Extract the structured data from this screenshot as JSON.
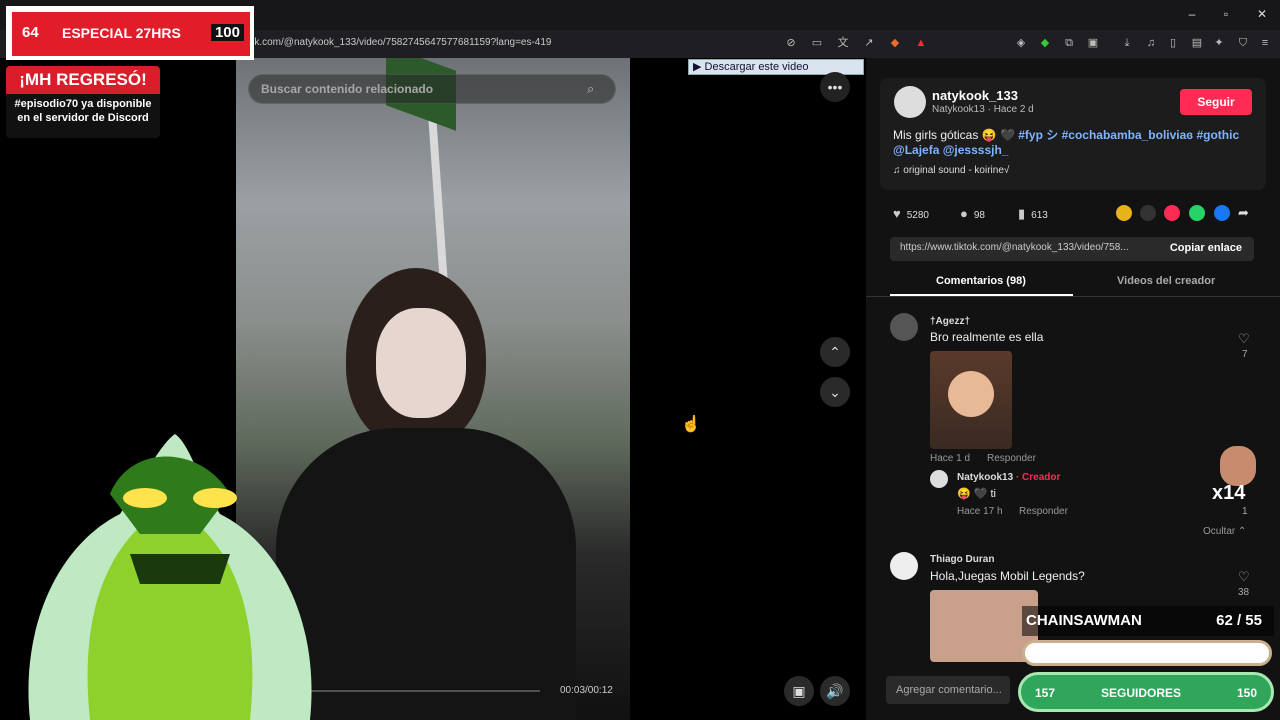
{
  "browser": {
    "url": "tiktok.com/@natykook_133/video/7582745647577681159?lang=es-419"
  },
  "overlay": {
    "score_left": "64",
    "score_title": "ESPECIAL 27HRS",
    "score_right": "100",
    "banner_title": "¡MH REGRESÓ!",
    "banner_line1": "#episodio70 ya disponible",
    "banner_line2": "en el servidor de Discord",
    "chainsaw_label": "CHAINSAWMAN",
    "chainsaw_count": "62  / 55",
    "followers_left": "157",
    "followers_label": "SEGUIDORES",
    "followers_right": "150",
    "multiplier": "x14"
  },
  "video": {
    "search_placeholder": "Buscar contenido relacionado",
    "timecode": "00:03/00:12"
  },
  "download_label": "Descargar este video",
  "post": {
    "username": "natykook_133",
    "handle": "Natykook13 · Hace 2 d",
    "follow_label": "Seguir",
    "caption_text": "Mis girls góticas 😝 🖤 ",
    "caption_tags": "#fyp シ #cochabamba_boliviaɞ #gothic",
    "caption_line2": "@Lajefa @jessssjh_",
    "sound": "original sound - koirine√",
    "likes": "5280",
    "comments": "98",
    "saves": "613",
    "link": "https://www.tiktok.com/@natykook_133/video/758...",
    "copy_link": "Copiar enlace"
  },
  "tabs": {
    "comments": "Comentarios (98)",
    "creator_videos": "Videos del creador"
  },
  "comments": [
    {
      "author": "†Agezz†",
      "text": "Bro realmente es ella",
      "time": "Hace 1 d",
      "reply": "Responder",
      "likes": "7"
    },
    {
      "author": "Thiago Duran",
      "text": "Hola,Juegas Mobil Legends?",
      "likes": "38"
    }
  ],
  "reply": {
    "author": "Natykook13",
    "badge": "· Creador",
    "text": "😝 🖤 ti",
    "time": "Hace 17 h",
    "reply_label": "Responder",
    "likes": "1",
    "hide_label": "Ocultar ⌃"
  },
  "add_comment_placeholder": "Agregar comentario..."
}
